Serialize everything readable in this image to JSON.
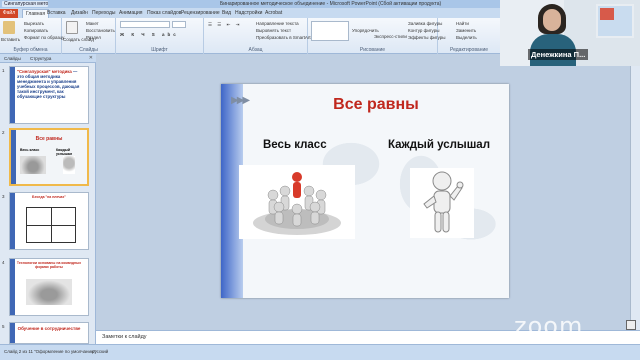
{
  "window": {
    "title": "Бинарированное методическое объединение - Microsoft PowerPoint (Сбой активации продукта)",
    "doc_tab": "Сингапурская методи..."
  },
  "ribbon_tabs": [
    "Файл",
    "Главная",
    "Вставка",
    "Дизайн",
    "Переходы",
    "Анимация",
    "Показ слайдов",
    "Рецензирование",
    "Вид",
    "Надстройки",
    "Acrobat"
  ],
  "ribbon": {
    "clipboard": {
      "name": "Буфер обмена",
      "paste": "Вставить",
      "cut": "Вырезать",
      "copy": "Копировать",
      "format": "Формат по образцу"
    },
    "slides": {
      "name": "Слайды",
      "new_slide": "Создать слайд",
      "layout": "Макет",
      "reset": "Восстановить",
      "section": "Раздел"
    },
    "font": {
      "name": "Шрифт"
    },
    "paragraph": {
      "name": "Абзац",
      "text_dir": "Направление текста",
      "align_text": "Выровнять текст",
      "smartart": "Преобразовать в SmartArt"
    },
    "drawing": {
      "name": "Рисование",
      "arrange": "Упорядочить",
      "quick_styles": "Экспресс-стили",
      "fill": "Заливка фигуры",
      "outline": "Контур фигуры",
      "effects": "Эффекты фигуры"
    },
    "editing": {
      "name": "Редактирование",
      "find": "Найти",
      "replace": "Заменить",
      "select": "Выделить"
    }
  },
  "video": {
    "name": "Денежкина П..."
  },
  "left_panel": {
    "tabs": [
      "Слайды",
      "Структура"
    ],
    "slides": [
      {
        "num": "1",
        "text_red": "\"Сингапурская\" методика",
        "text": " — это общая методика менеджмента и управления учебных процессов, дающая такой инструмент, как обучающие структуры"
      },
      {
        "num": "2",
        "title": "Все равны",
        "sub1": "Весь класс",
        "sub2": "Каждый услышал"
      },
      {
        "num": "3",
        "title": "Беседа \"на плечах\""
      },
      {
        "num": "4",
        "title": "Технологии основаны на командных формах работы"
      },
      {
        "num": "5",
        "title": "Обучение в сотрудничестве"
      }
    ]
  },
  "slide": {
    "title": "Все равны",
    "label_left": "Весь класс",
    "label_right": "Каждый услышал",
    "arrows": "▶▶▶"
  },
  "notes": {
    "placeholder": "Заметки к слайду"
  },
  "status": {
    "slide": "Слайд 2 из 11",
    "theme": "\"Оформление по умолчанию\"",
    "lang": "русский"
  },
  "watermark": "zoom"
}
